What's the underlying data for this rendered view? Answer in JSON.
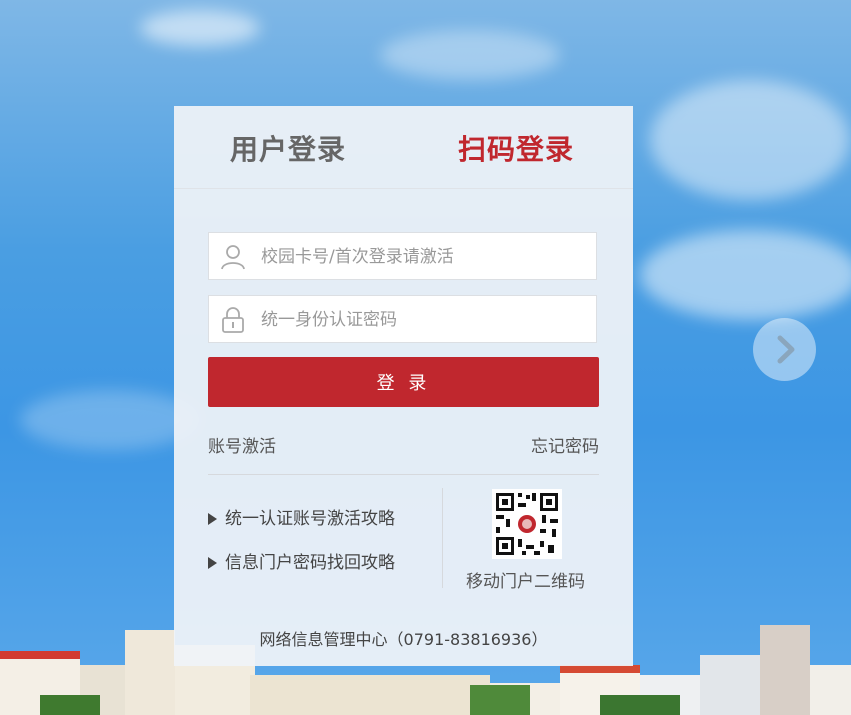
{
  "tabs": {
    "user_login": "用户登录",
    "qr_login": "扫码登录"
  },
  "form": {
    "username_placeholder": "校园卡号/首次登录请激活",
    "password_placeholder": "统一身份认证密码",
    "login_button": "登 录"
  },
  "links": {
    "activate": "账号激活",
    "forgot": "忘记密码"
  },
  "guides": [
    "统一认证账号激活攻略",
    "信息门户密码找回攻略"
  ],
  "qr": {
    "label": "移动门户二维码"
  },
  "footer": {
    "text": "网络信息管理中心（0791-83816936）"
  },
  "colors": {
    "accent": "#c0272e"
  },
  "icons": {
    "user": "user-icon",
    "lock": "lock-icon",
    "next": "chevron-right-icon"
  }
}
